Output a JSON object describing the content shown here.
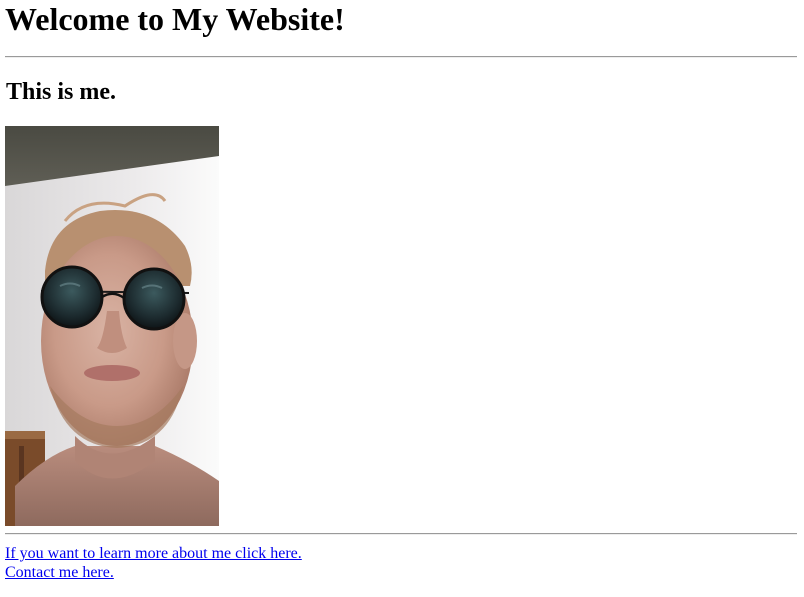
{
  "page": {
    "heading": "Welcome to My Website!",
    "subheading": "This is me."
  },
  "photo": {
    "subject": "selfie-portrait-with-round-sunglasses"
  },
  "links": {
    "learn_more": "If you want to learn more about me click here.",
    "contact": "Contact me here."
  },
  "colors": {
    "link": "#0000ee",
    "text": "#000000",
    "background": "#ffffff",
    "rule": "#9a9a9a"
  }
}
